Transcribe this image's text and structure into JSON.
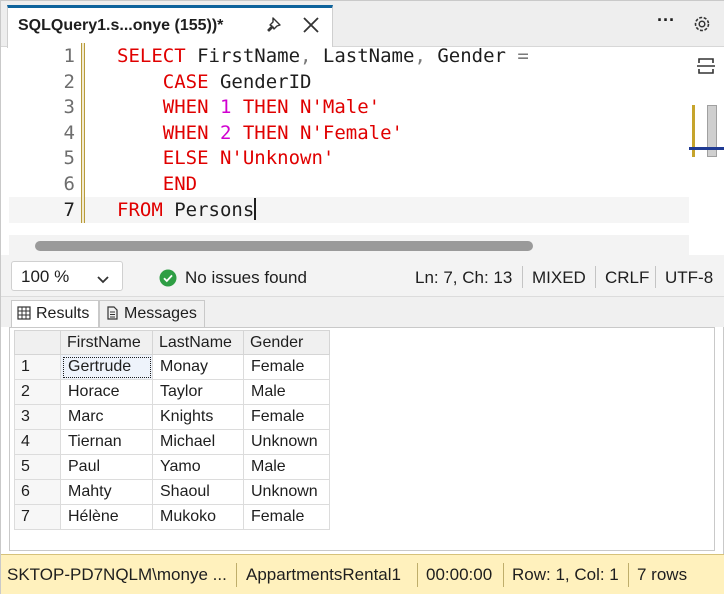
{
  "tab": {
    "title": "SQLQuery1.s...onye (155))*"
  },
  "editor": {
    "lines": [
      {
        "num": "1",
        "parts": [
          {
            "t": "SELECT ",
            "c": "kw"
          },
          {
            "t": "FirstName",
            "c": "pln"
          },
          {
            "t": ", ",
            "c": "op"
          },
          {
            "t": "LastName",
            "c": "pln"
          },
          {
            "t": ", ",
            "c": "op"
          },
          {
            "t": "Gender ",
            "c": "pln"
          },
          {
            "t": "=",
            "c": "op"
          }
        ]
      },
      {
        "num": "2",
        "parts": [
          {
            "t": "    CASE ",
            "c": "kw"
          },
          {
            "t": "GenderID",
            "c": "pln"
          }
        ]
      },
      {
        "num": "3",
        "parts": [
          {
            "t": "    WHEN ",
            "c": "kw"
          },
          {
            "t": "1",
            "c": "num"
          },
          {
            "t": " THEN ",
            "c": "kw"
          },
          {
            "t": "N'Male'",
            "c": "str"
          }
        ]
      },
      {
        "num": "4",
        "parts": [
          {
            "t": "    WHEN ",
            "c": "kw"
          },
          {
            "t": "2",
            "c": "num"
          },
          {
            "t": " THEN ",
            "c": "kw"
          },
          {
            "t": "N'Female'",
            "c": "str"
          }
        ]
      },
      {
        "num": "5",
        "parts": [
          {
            "t": "    ELSE ",
            "c": "kw"
          },
          {
            "t": "N'Unknown'",
            "c": "str"
          }
        ]
      },
      {
        "num": "6",
        "parts": [
          {
            "t": "    END",
            "c": "kw"
          }
        ]
      },
      {
        "num": "7",
        "parts": [
          {
            "t": "FROM ",
            "c": "kw"
          },
          {
            "t": "Persons",
            "c": "pln"
          }
        ]
      }
    ],
    "current_line": 7
  },
  "status_bar": {
    "zoom": "100 %",
    "issues": "No issues found",
    "position": "Ln: 7, Ch: 13",
    "tabs_mode": "MIXED",
    "line_endings": "CRLF",
    "encoding": "UTF-8"
  },
  "results_tabs": {
    "results": "Results",
    "messages": "Messages"
  },
  "grid": {
    "columns": [
      "FirstName",
      "LastName",
      "Gender"
    ],
    "rows": [
      [
        "1",
        "Gertrude",
        "Monay",
        "Female"
      ],
      [
        "2",
        "Horace",
        "Taylor",
        "Male"
      ],
      [
        "3",
        "Marc",
        "Knights",
        "Female"
      ],
      [
        "4",
        "Tiernan",
        "Michael",
        "Unknown"
      ],
      [
        "5",
        "Paul",
        "Yamo",
        "Male"
      ],
      [
        "6",
        "Mahty",
        "Shaoul",
        "Unknown"
      ],
      [
        "7",
        "Hélène",
        "Mukoko",
        "Female"
      ]
    ]
  },
  "query_status": {
    "connection": "SKTOP-PD7NQLM\\monye ...",
    "database": "AppartmentsRental1",
    "elapsed": "00:00:00",
    "cursor": "Row: 1, Col: 1",
    "row_count": "7 rows"
  },
  "colors": {
    "keyword": "#e00000",
    "number": "#d000d0",
    "status_bar_bg": "#fff1bd",
    "ok_green": "#2e9e44"
  },
  "icons": [
    "pin-icon",
    "close-icon",
    "more-icon",
    "gear-icon",
    "split-editor-icon",
    "chevron-down-icon",
    "check-circle-icon",
    "grid-icon",
    "messages-icon"
  ]
}
